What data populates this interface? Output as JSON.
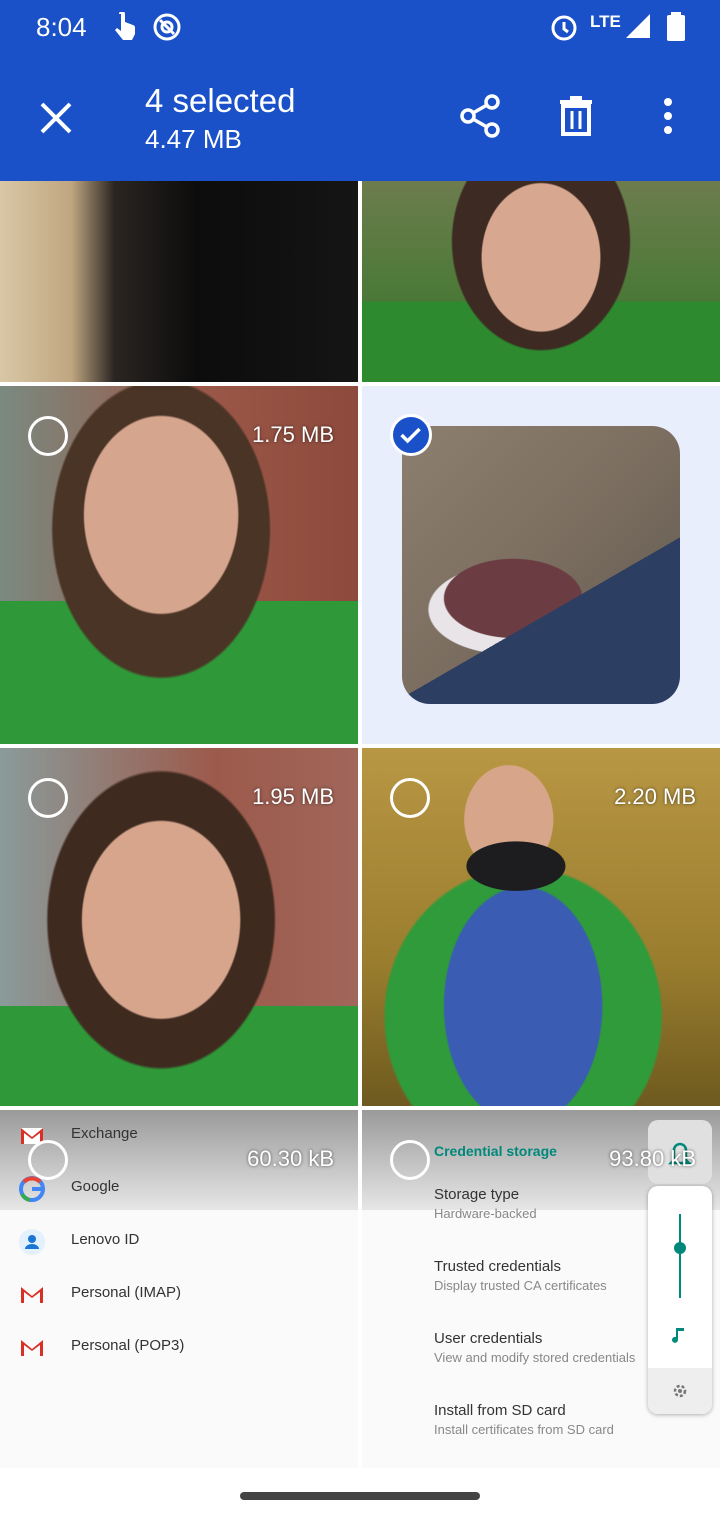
{
  "status_bar": {
    "time": "8:04",
    "network": "LTE",
    "icons": [
      "touch-gesture-icon",
      "app-notification-icon",
      "alarm-icon",
      "signal-icon",
      "battery-icon"
    ]
  },
  "app_bar": {
    "title": "4 selected",
    "subtitle": "4.47 MB",
    "actions": [
      "close",
      "share",
      "delete",
      "more-options"
    ]
  },
  "grid": {
    "tiles": [
      {
        "size": "",
        "selected": false,
        "kind": "dark-photo"
      },
      {
        "size": "",
        "selected": false,
        "kind": "outdoor-photo"
      },
      {
        "size": "1.75 MB",
        "selected": false
      },
      {
        "size": "",
        "selected": true
      },
      {
        "size": "1.95 MB",
        "selected": false
      },
      {
        "size": "2.20 MB",
        "selected": false
      },
      {
        "size": "60.30 kB",
        "selected": false
      },
      {
        "size": "93.80 kB",
        "selected": false
      }
    ]
  },
  "screenshot_accounts": {
    "items": [
      "Exchange",
      "Google",
      "Lenovo ID",
      "Personal (IMAP)",
      "Personal (POP3)"
    ]
  },
  "screenshot_credentials": {
    "section": "Credential storage",
    "items": [
      {
        "title": "Storage type",
        "subtitle": "Hardware-backed"
      },
      {
        "title": "Trusted credentials",
        "subtitle": "Display trusted CA certificates"
      },
      {
        "title": "User credentials",
        "subtitle": "View and modify stored credentials"
      },
      {
        "title": "Install from SD card",
        "subtitle": "Install certificates from SD card"
      }
    ]
  },
  "colors": {
    "accent": "#1a51c8",
    "selected_tile_bg": "#e8eefb",
    "teal": "#00897b"
  }
}
